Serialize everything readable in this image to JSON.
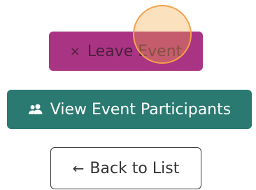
{
  "buttons": {
    "leave_event": {
      "label": "Leave Event",
      "icon": "close-icon",
      "icon_glyph": "×",
      "color": "#a3237a"
    },
    "view_participants": {
      "label": "View Event Participants",
      "icon": "users-icon",
      "color": "#2b7a71"
    },
    "back_to_list": {
      "label": "Back to List",
      "icon": "arrow-left-icon",
      "icon_glyph": "←"
    }
  },
  "cursor": {
    "color": "#f3a24a"
  }
}
